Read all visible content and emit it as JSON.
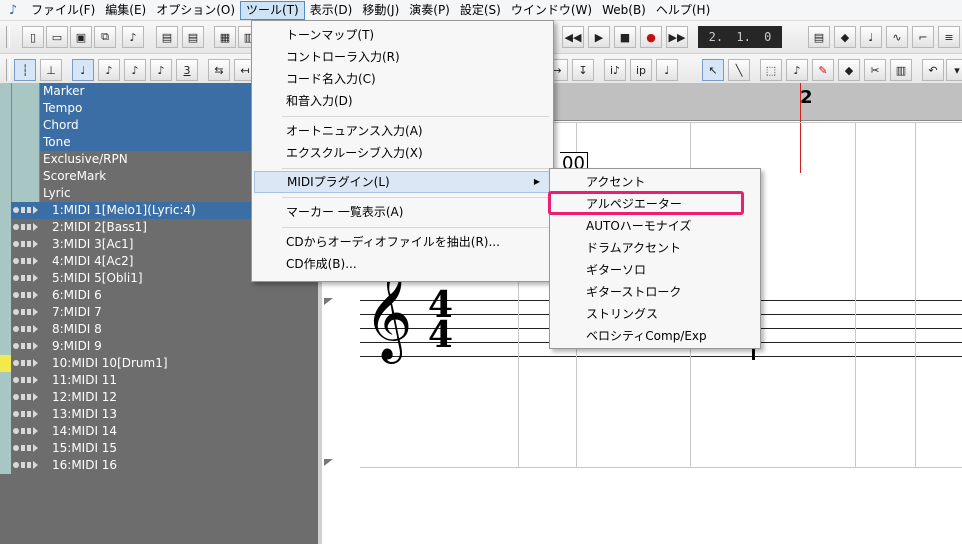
{
  "menubar": {
    "items": [
      "ファイル(F)",
      "編集(E)",
      "オプション(O)",
      "ツール(T)",
      "表示(D)",
      "移動(J)",
      "演奏(P)",
      "設定(S)",
      "ウインドウ(W)",
      "Web(B)",
      "ヘルプ(H)"
    ],
    "active_index": 3
  },
  "toolbar": {
    "counter": [
      "2.",
      "1.",
      "0"
    ],
    "note_3_label": "3",
    "icon_names": [
      "new-file-icon",
      "open-file-icon",
      "save-icon",
      "copy-icon",
      "rewind-icon",
      "play-icon",
      "stop-icon",
      "record-icon",
      "fast-forward-icon",
      "pointer-icon",
      "pencil-icon"
    ]
  },
  "tracks": {
    "system": [
      "Marker",
      "Tempo",
      "Chord",
      "Tone",
      "Exclusive/RPN",
      "ScoreMark",
      "Lyric"
    ],
    "system_selected": [
      true,
      true,
      true,
      true,
      false,
      false,
      false
    ],
    "midi": [
      "1:MIDI 1[Melo1](Lyric:4)",
      "2:MIDI 2[Bass1]",
      "3:MIDI 3[Ac1]",
      "4:MIDI 4[Ac2]",
      "5:MIDI 5[Obli1]",
      "6:MIDI 6",
      "7:MIDI 7",
      "8:MIDI 8",
      "9:MIDI 9",
      "10:MIDI 10[Drum1]",
      "11:MIDI 11",
      "12:MIDI 12",
      "13:MIDI 13",
      "14:MIDI 14",
      "15:MIDI 15",
      "16:MIDI 16"
    ],
    "midi_selected_index": 0,
    "highlight_track_index": 9
  },
  "score": {
    "measure_label": "2",
    "clef": "𝄞",
    "time_sig_top": "4",
    "time_sig_bottom": "4",
    "lyric_fragment": "00"
  },
  "tools_menu": {
    "items": [
      {
        "label": "トーンマップ(T)",
        "submenu": false
      },
      {
        "label": "コントローラ入力(R)",
        "submenu": false
      },
      {
        "label": "コード名入力(C)",
        "submenu": false
      },
      {
        "label": "和音入力(D)",
        "submenu": false
      },
      {
        "label": "オートニュアンス入力(A)",
        "submenu": false
      },
      {
        "label": "エクスクルーシブ入力(X)",
        "submenu": false
      },
      {
        "label": "MIDIプラグイン(L)",
        "submenu": true
      },
      {
        "label": "マーカー 一覧表示(A)",
        "submenu": false
      },
      {
        "label": "CDからオーディオファイルを抽出(R)...",
        "submenu": false
      },
      {
        "label": "CD作成(B)...",
        "submenu": false
      }
    ],
    "hover_index": 6
  },
  "midi_plugin_menu": {
    "items": [
      "アクセント",
      "アルペジエーター",
      "AUTOハーモナイズ",
      "ドラムアクセント",
      "ギターソロ",
      "ギターストローク",
      "ストリングス",
      "ベロシティComp/Exp"
    ],
    "highlighted_index": 1,
    "highlight_color": "#ee1d6f"
  }
}
